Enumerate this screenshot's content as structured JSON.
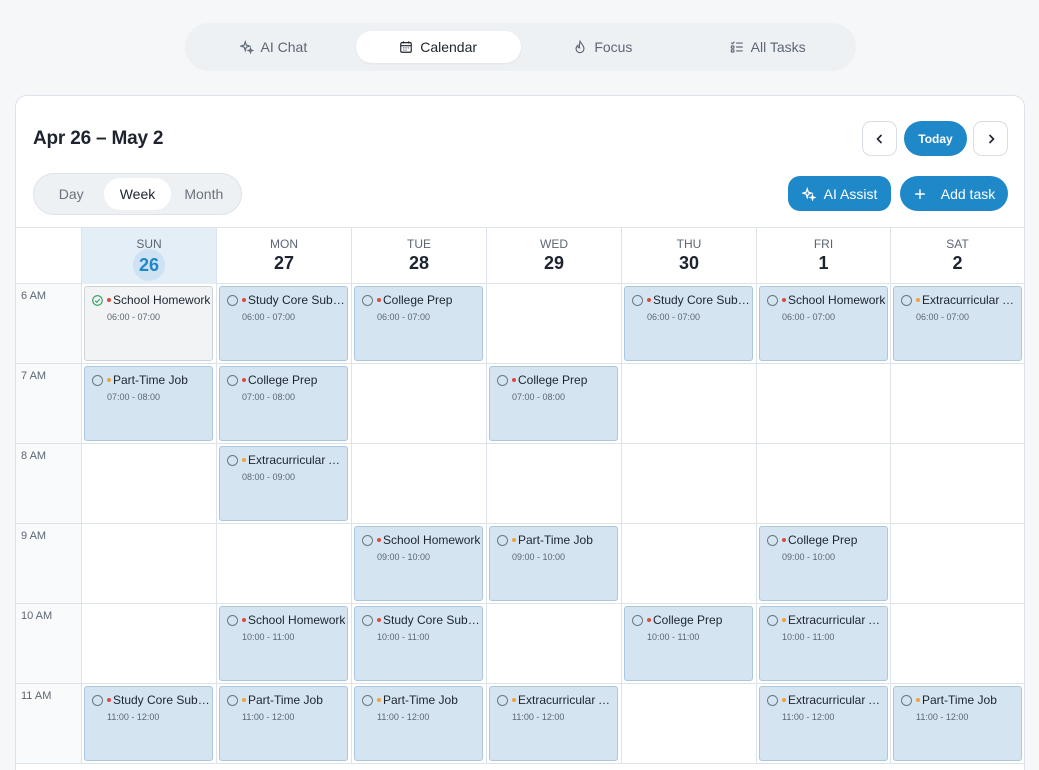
{
  "nav": {
    "tabs": [
      {
        "label": "AI Chat",
        "icon": "sparkles-icon",
        "active": false
      },
      {
        "label": "Calendar",
        "icon": "calendar-icon",
        "active": true
      },
      {
        "label": "Focus",
        "icon": "flame-icon",
        "active": false
      },
      {
        "label": "All Tasks",
        "icon": "checklist-icon",
        "active": false
      }
    ]
  },
  "header": {
    "range_title": "Apr 26 – May 2",
    "today_label": "Today",
    "views": [
      "Day",
      "Week",
      "Month"
    ],
    "active_view": "Week",
    "ai_assist_label": "AI Assist",
    "add_task_label": "Add task"
  },
  "days": [
    {
      "name": "SUN",
      "num": "26",
      "today": true
    },
    {
      "name": "MON",
      "num": "27",
      "today": false
    },
    {
      "name": "TUE",
      "num": "28",
      "today": false
    },
    {
      "name": "WED",
      "num": "29",
      "today": false
    },
    {
      "name": "THU",
      "num": "30",
      "today": false
    },
    {
      "name": "FRI",
      "num": "1",
      "today": false
    },
    {
      "name": "SAT",
      "num": "2",
      "today": false
    }
  ],
  "hours": [
    "6 AM",
    "7 AM",
    "8 AM",
    "9 AM",
    "10 AM",
    "11 AM"
  ],
  "colors": {
    "accent": "#1e88c8",
    "priority_high": "#e0473e",
    "priority_medium": "#f0a23b"
  },
  "events": [
    {
      "day": 0,
      "hour": 0,
      "title": "School Homework",
      "time": "06:00 - 07:00",
      "priority": "high",
      "done": true
    },
    {
      "day": 1,
      "hour": 0,
      "title": "Study Core Subjects",
      "time": "06:00 - 07:00",
      "priority": "high",
      "done": false
    },
    {
      "day": 2,
      "hour": 0,
      "title": "College Prep",
      "time": "06:00 - 07:00",
      "priority": "high",
      "done": false
    },
    {
      "day": 4,
      "hour": 0,
      "title": "Study Core Subjects",
      "time": "06:00 - 07:00",
      "priority": "high",
      "done": false
    },
    {
      "day": 5,
      "hour": 0,
      "title": "School Homework",
      "time": "06:00 - 07:00",
      "priority": "high",
      "done": false
    },
    {
      "day": 6,
      "hour": 0,
      "title": "Extracurricular Activities",
      "time": "06:00 - 07:00",
      "priority": "medium",
      "done": false
    },
    {
      "day": 0,
      "hour": 1,
      "title": "Part-Time Job",
      "time": "07:00 - 08:00",
      "priority": "medium",
      "done": false
    },
    {
      "day": 1,
      "hour": 1,
      "title": "College Prep",
      "time": "07:00 - 08:00",
      "priority": "high",
      "done": false
    },
    {
      "day": 3,
      "hour": 1,
      "title": "College Prep",
      "time": "07:00 - 08:00",
      "priority": "high",
      "done": false
    },
    {
      "day": 1,
      "hour": 2,
      "title": "Extracurricular Activities",
      "time": "08:00 - 09:00",
      "priority": "medium",
      "done": false
    },
    {
      "day": 2,
      "hour": 3,
      "title": "School Homework",
      "time": "09:00 - 10:00",
      "priority": "high",
      "done": false
    },
    {
      "day": 3,
      "hour": 3,
      "title": "Part-Time Job",
      "time": "09:00 - 10:00",
      "priority": "medium",
      "done": false
    },
    {
      "day": 5,
      "hour": 3,
      "title": "College Prep",
      "time": "09:00 - 10:00",
      "priority": "high",
      "done": false
    },
    {
      "day": 1,
      "hour": 4,
      "title": "School Homework",
      "time": "10:00 - 11:00",
      "priority": "high",
      "done": false
    },
    {
      "day": 2,
      "hour": 4,
      "title": "Study Core Subjects",
      "time": "10:00 - 11:00",
      "priority": "high",
      "done": false
    },
    {
      "day": 4,
      "hour": 4,
      "title": "College Prep",
      "time": "10:00 - 11:00",
      "priority": "high",
      "done": false
    },
    {
      "day": 5,
      "hour": 4,
      "title": "Extracurricular Activities",
      "time": "10:00 - 11:00",
      "priority": "medium",
      "done": false
    },
    {
      "day": 0,
      "hour": 5,
      "title": "Study Core Subjects",
      "time": "11:00 - 12:00",
      "priority": "high",
      "done": false
    },
    {
      "day": 1,
      "hour": 5,
      "title": "Part-Time Job",
      "time": "11:00 - 12:00",
      "priority": "medium",
      "done": false
    },
    {
      "day": 2,
      "hour": 5,
      "title": "Part-Time Job",
      "time": "11:00 - 12:00",
      "priority": "medium",
      "done": false
    },
    {
      "day": 3,
      "hour": 5,
      "title": "Extracurricular Activities",
      "time": "11:00 - 12:00",
      "priority": "medium",
      "done": false
    },
    {
      "day": 5,
      "hour": 5,
      "title": "Extracurricular Activities",
      "time": "11:00 - 12:00",
      "priority": "medium",
      "done": false
    },
    {
      "day": 6,
      "hour": 5,
      "title": "Part-Time Job",
      "time": "11:00 - 12:00",
      "priority": "medium",
      "done": false
    }
  ]
}
